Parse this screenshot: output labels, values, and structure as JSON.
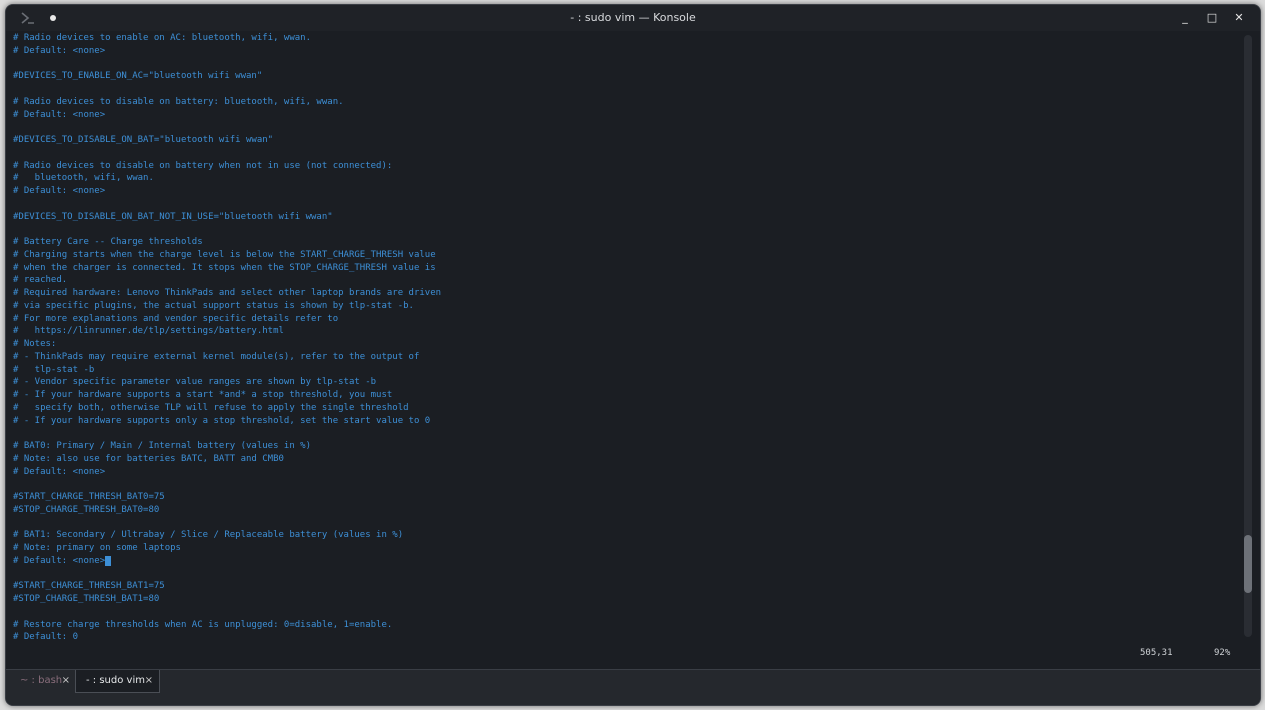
{
  "window": {
    "title": "- : sudo vim — Konsole"
  },
  "editor": {
    "lines": [
      "# Radio devices to enable on AC: bluetooth, wifi, wwan.",
      "# Default: <none>",
      "",
      "#DEVICES_TO_ENABLE_ON_AC=\"bluetooth wifi wwan\"",
      "",
      "# Radio devices to disable on battery: bluetooth, wifi, wwan.",
      "# Default: <none>",
      "",
      "#DEVICES_TO_DISABLE_ON_BAT=\"bluetooth wifi wwan\"",
      "",
      "# Radio devices to disable on battery when not in use (not connected):",
      "#   bluetooth, wifi, wwan.",
      "# Default: <none>",
      "",
      "#DEVICES_TO_DISABLE_ON_BAT_NOT_IN_USE=\"bluetooth wifi wwan\"",
      "",
      "# Battery Care -- Charge thresholds",
      "# Charging starts when the charge level is below the START_CHARGE_THRESH value",
      "# when the charger is connected. It stops when the STOP_CHARGE_THRESH value is",
      "# reached.",
      "# Required hardware: Lenovo ThinkPads and select other laptop brands are driven",
      "# via specific plugins, the actual support status is shown by tlp-stat -b.",
      "# For more explanations and vendor specific details refer to",
      "#   https://linrunner.de/tlp/settings/battery.html",
      "# Notes:",
      "# - ThinkPads may require external kernel module(s), refer to the output of",
      "#   tlp-stat -b",
      "# - Vendor specific parameter value ranges are shown by tlp-stat -b",
      "# - If your hardware supports a start *and* a stop threshold, you must",
      "#   specify both, otherwise TLP will refuse to apply the single threshold",
      "# - If your hardware supports only a stop threshold, set the start value to 0",
      "",
      "# BAT0: Primary / Main / Internal battery (values in %)",
      "# Note: also use for batteries BATC, BATT and CMB0",
      "# Default: <none>",
      "",
      "#START_CHARGE_THRESH_BAT0=75",
      "#STOP_CHARGE_THRESH_BAT0=80",
      "",
      "# BAT1: Secondary / Ultrabay / Slice / Replaceable battery (values in %)",
      "# Note: primary on some laptops",
      "# Default: <none>",
      "",
      "#START_CHARGE_THRESH_BAT1=75",
      "#STOP_CHARGE_THRESH_BAT1=80",
      "",
      "# Restore charge thresholds when AC is unplugged: 0=disable, 1=enable.",
      "# Default: 0"
    ],
    "cursor_line": 41,
    "cursor_col": 31,
    "status_position": "505,31",
    "status_percent": "92%",
    "scroll_fraction": 0.92
  },
  "tabs": [
    {
      "label": "~ : bash",
      "active": false
    },
    {
      "label": "- : sudo vim",
      "active": true
    }
  ],
  "icons": {
    "close": "×",
    "minimize": "_",
    "maximize": "□",
    "window_close": "✕"
  },
  "colors": {
    "text": "#3d8fd6",
    "background": "#1b1e23"
  }
}
